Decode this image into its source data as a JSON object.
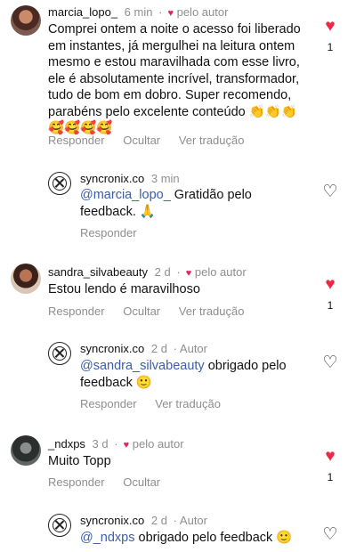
{
  "comments": [
    {
      "username": "marcia_lopo_",
      "time": "6 min",
      "author_label": "pelo autor",
      "text": "Comprei ontem a noite o acesso foi liberado em instantes, já mergulhei na leitura ontem mesmo e estou maravilhada com esse livro, ele é absolutamente incrível, transformador, tudo de bom em dobro. Super recomendo, parabéns pelo excelente conteúdo 👏👏👏🥰🥰🥰🥰",
      "actions": [
        "Responder",
        "Ocultar",
        "Ver tradução"
      ],
      "likes": "1"
    },
    {
      "username": "syncronix.co",
      "time": "3 min",
      "mention": "@marcia_lopo_",
      "text": " Gratidão pelo feedback. 🙏",
      "actions": [
        "Responder"
      ]
    },
    {
      "username": "sandra_silvabeauty",
      "time": "2 d",
      "author_label": "pelo autor",
      "text": "Estou lendo  é maravilhoso",
      "actions": [
        "Responder",
        "Ocultar",
        "Ver tradução"
      ],
      "likes": "1"
    },
    {
      "username": "syncronix.co",
      "time": "2 d",
      "badge": "Autor",
      "mention": "@sandra_silvabeauty",
      "text": " obrigado pelo feedback 🙂",
      "actions": [
        "Responder",
        "Ver tradução"
      ]
    },
    {
      "username": "_ndxps",
      "time": "3 d",
      "author_label": "pelo autor",
      "text": "Muito Topp",
      "actions": [
        "Responder",
        "Ocultar"
      ],
      "likes": "1"
    },
    {
      "username": "syncronix.co",
      "time": "2 d",
      "badge": "Autor",
      "mention": "@_ndxps",
      "text": " obrigado pelo feedback 🙂"
    }
  ],
  "colors": {
    "like_red": "#ed2a46",
    "mention_blue": "#3b5ea8",
    "muted_gray": "#8e8e8e"
  },
  "icons": {
    "like_filled": "heart-filled-icon",
    "like_outline": "heart-outline-icon",
    "brand_logo": "syncronix-logo-icon"
  }
}
